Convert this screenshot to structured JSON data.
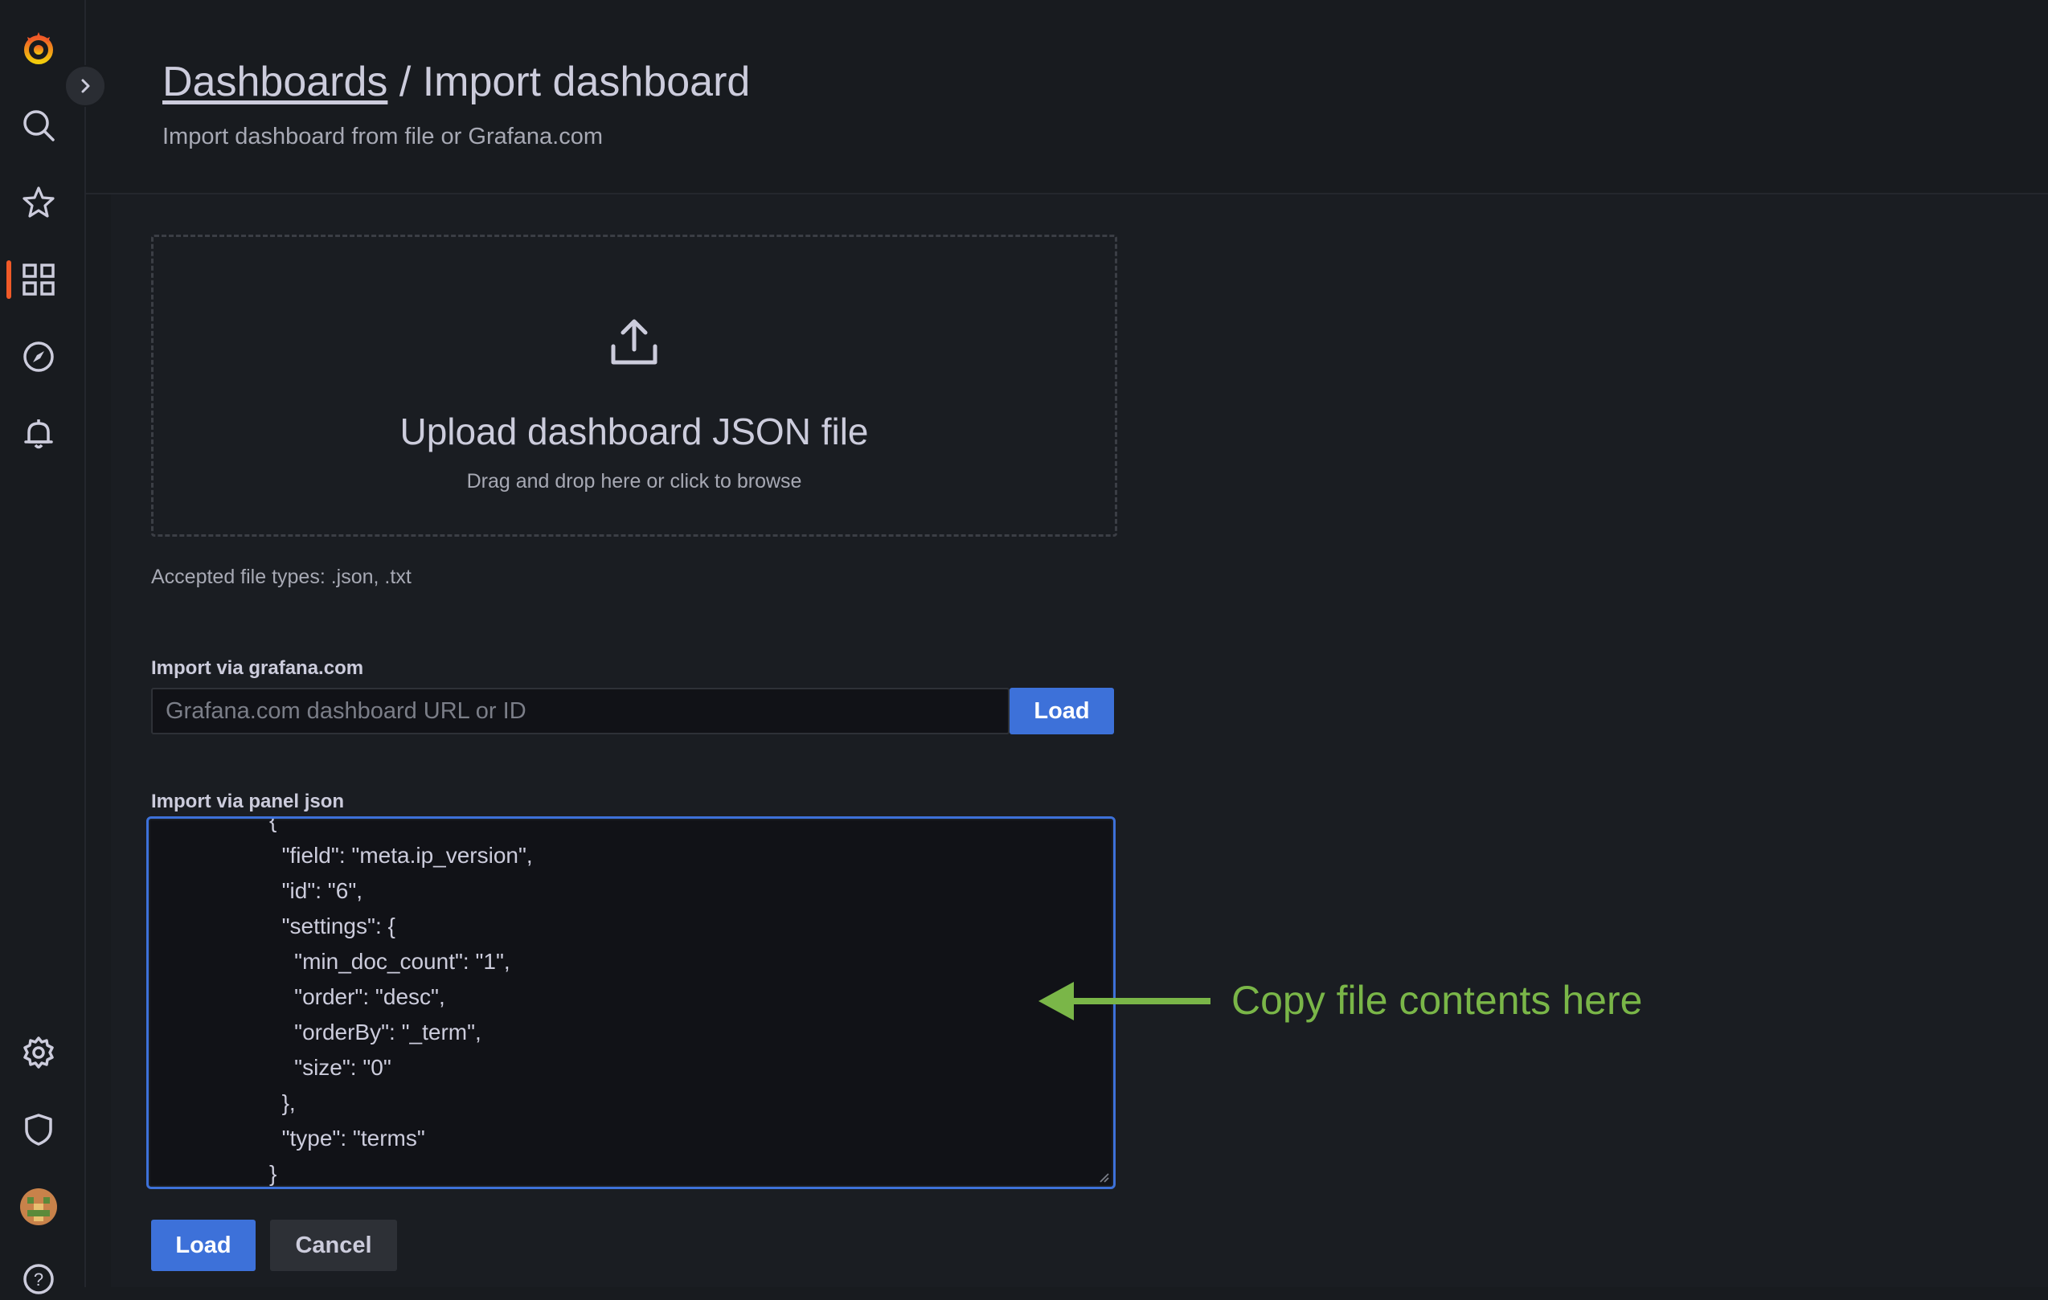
{
  "sidebar": {
    "items": [
      {
        "icon": "grafana-logo-icon"
      },
      {
        "icon": "search-icon"
      },
      {
        "icon": "star-icon"
      },
      {
        "icon": "dashboards-icon",
        "active": true
      },
      {
        "icon": "compass-icon"
      },
      {
        "icon": "bell-icon"
      },
      {
        "icon": "gear-icon"
      },
      {
        "icon": "shield-icon"
      },
      {
        "icon": "avatar"
      },
      {
        "icon": "help-icon"
      }
    ],
    "active_color": "#f05a28"
  },
  "header": {
    "breadcrumb_parent": "Dashboards",
    "breadcrumb_separator": " / ",
    "title": "Import dashboard",
    "subtitle": "Import dashboard from file or Grafana.com"
  },
  "upload": {
    "title": "Upload dashboard JSON file",
    "subtitle": "Drag and drop here or click to browse",
    "accepted_types": "Accepted file types: .json, .txt"
  },
  "grafana_com": {
    "label": "Import via grafana.com",
    "placeholder": "Grafana.com dashboard URL or ID",
    "value": "",
    "load_label": "Load"
  },
  "panel_json": {
    "label": "Import via panel json",
    "content": "         {\n           \"field\": \"meta.ip_version\",\n           \"id\": \"6\",\n           \"settings\": {\n             \"min_doc_count\": \"1\",\n             \"order\": \"desc\",\n             \"orderBy\": \"_term\",\n             \"size\": \"0\"\n           },\n           \"type\": \"terms\"\n         }"
  },
  "actions": {
    "load_label": "Load",
    "cancel_label": "Cancel"
  },
  "annotation": {
    "text": "Copy file contents here",
    "color": "#7ab648"
  },
  "colors": {
    "primary": "#3d71d9",
    "background": "#181b1f"
  }
}
